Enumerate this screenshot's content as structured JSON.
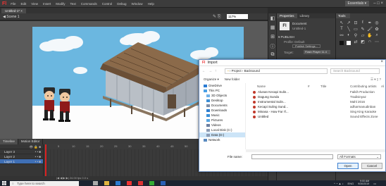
{
  "menubar": {
    "logo": "Fl",
    "items": [
      "File",
      "Edit",
      "View",
      "Insert",
      "Modify",
      "Text",
      "Commands",
      "Control",
      "Debug",
      "Window",
      "Help"
    ],
    "workspace": "Essentials ▾",
    "window_controls": "–  □  ×"
  },
  "doc_tab": "Untitled-1* ×",
  "editbar": {
    "scene": "Scene 1",
    "zoom": "117%"
  },
  "timeline": {
    "tabs": [
      "Timeline",
      "Motion Editor"
    ],
    "layers": [
      "Layer 3",
      "Layer 2",
      "Layer 1"
    ],
    "ruler_ticks": [
      "5",
      "10",
      "15",
      "20",
      "25",
      "30",
      "35",
      "40",
      "45",
      "50",
      "55",
      "60",
      "65",
      "70",
      "75"
    ],
    "footer": "24.00 fps   0.0 s"
  },
  "properties": {
    "tabs": [
      "Properties",
      "Library"
    ],
    "doc_icon": "Fl",
    "doc_label": "Document",
    "doc_name": "Untitled-1",
    "section": "PUBLISH",
    "profile_label": "Profile: Default",
    "publish_settings": "Publish Settings...",
    "target_label": "Target:",
    "target_value": "Flash Player 11.4"
  },
  "tools": {
    "tab": "Tools"
  },
  "dialog": {
    "title": "Import",
    "path": "›  Project  ›  Backsound",
    "search_placeholder": "Search Backsound",
    "organize": "Organize ▾",
    "new_folder": "New folder",
    "nav_items": [
      {
        "label": "OneDrive",
        "color": "#2b7cd3",
        "indent": false,
        "selected": false
      },
      {
        "label": "This PC",
        "color": "#4aa0e6",
        "indent": false,
        "selected": false
      },
      {
        "label": "3D Objects",
        "color": "#6fb1e8",
        "indent": true,
        "selected": false
      },
      {
        "label": "Desktop",
        "color": "#3d8fd6",
        "indent": true,
        "selected": false
      },
      {
        "label": "Documents",
        "color": "#7d8ea8",
        "indent": true,
        "selected": false
      },
      {
        "label": "Downloads",
        "color": "#2f7fd0",
        "indent": true,
        "selected": false
      },
      {
        "label": "Music",
        "color": "#3d8fd6",
        "indent": true,
        "selected": false
      },
      {
        "label": "Pictures",
        "color": "#5aa5e0",
        "indent": true,
        "selected": false
      },
      {
        "label": "Videos",
        "color": "#6c7fa0",
        "indent": true,
        "selected": false
      },
      {
        "label": "Local Disk (C:)",
        "color": "#8a9bb5",
        "indent": true,
        "selected": false
      },
      {
        "label": "Data (D:)",
        "color": "#8a9bb5",
        "indent": true,
        "selected": true
      },
      {
        "label": "Network",
        "color": "#5a8ac0",
        "indent": false,
        "selected": false
      }
    ],
    "columns": [
      "Name",
      "#",
      "Title",
      "Contributing artists",
      "Al"
    ],
    "files": [
      {
        "name": "Alunan Kecapi Sulin...",
        "artist": "Faikih Production"
      },
      {
        "name": "Dagung Sunda",
        "artist": "Tradisinyaz"
      },
      {
        "name": "Instrumental Sulin...",
        "artist": "Mahl 2016"
      },
      {
        "name": "Kecapi Suling Sund...",
        "artist": "adharmanudinban"
      },
      {
        "name": "Minasa - How Far I'l...",
        "artist": "Sing King Karaoke"
      },
      {
        "name": "Untitled",
        "artist": "Sound Effects Zone"
      }
    ],
    "filename_label": "File name:",
    "filename_value": "",
    "format": "All Formats",
    "open": "Open",
    "cancel": "Cancel"
  },
  "taskbar": {
    "search_placeholder": "Type here to search",
    "time": "9:00 AM",
    "date": "9/30/2019",
    "lang": "ENG"
  }
}
